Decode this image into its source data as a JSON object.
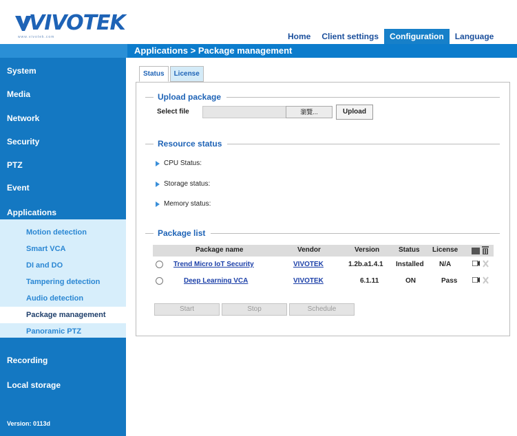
{
  "header": {
    "logo_text": "VIVOTEK",
    "logo_url_text": "www.vivotek.com",
    "nav": [
      "Home",
      "Client settings",
      "Configuration",
      "Language"
    ],
    "active_nav": "Configuration"
  },
  "page_title": "Applications  > Package management",
  "sidebar": {
    "items": [
      "System",
      "Media",
      "Network",
      "Security",
      "PTZ",
      "Event",
      "Applications"
    ],
    "sub_items": [
      "Motion detection",
      "Smart VCA",
      "DI and DO",
      "Tampering detection",
      "Audio detection",
      "Package management",
      "Panoramic PTZ"
    ],
    "selected_sub": "Package management",
    "bottom_items": [
      "Recording",
      "Local storage"
    ],
    "version": "Version: 0113d"
  },
  "tabs": [
    "Status",
    "License"
  ],
  "upload": {
    "title": "Upload package",
    "select_file_label": "Select file",
    "browse_label": "瀏覽...",
    "upload_label": "Upload"
  },
  "resource": {
    "title": "Resource status",
    "rows": [
      "CPU Status:",
      "Storage status:",
      "Memory status:"
    ]
  },
  "packages": {
    "title": "Package list",
    "columns": [
      "Package name",
      "Vendor",
      "Version",
      "Status",
      "License"
    ],
    "rows": [
      {
        "name": "Trend Micro IoT Security",
        "vendor": "VIVOTEK",
        "version": "1.2b.a1.4.1",
        "status": "Installed",
        "license": "N/A"
      },
      {
        "name": "Deep Learning VCA",
        "vendor": "VIVOTEK",
        "version": "6.1.11",
        "status": "ON",
        "license": "Pass"
      }
    ]
  },
  "actions": {
    "start": "Start",
    "stop": "Stop",
    "schedule": "Schedule"
  },
  "colors": {
    "brand_blue": "#1478c2",
    "link_blue": "#1b3fa8",
    "submenu_bg": "#d7eefb"
  }
}
